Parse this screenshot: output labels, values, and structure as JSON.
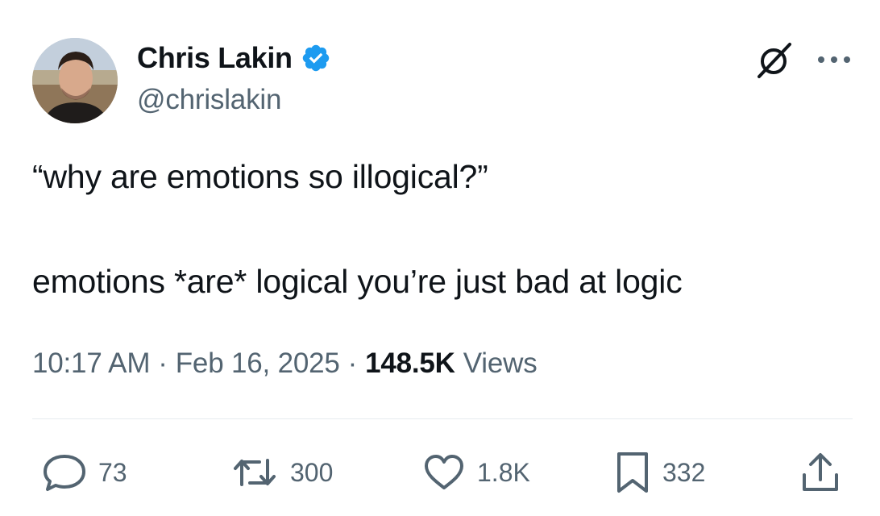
{
  "author": {
    "display_name": "Chris Lakin",
    "handle": "@chrislakin",
    "verified": true,
    "verified_color": "#1d9bf0"
  },
  "tweet": {
    "line1": "“why are emotions so illogical?”",
    "line2": "emotions *are* logical you’re just bad at logic"
  },
  "meta": {
    "time": "10:17 AM",
    "separator": "·",
    "date": "Feb 16, 2025",
    "views_count": "148.5K",
    "views_label": "Views"
  },
  "actions": {
    "replies": "73",
    "reposts": "300",
    "likes": "1.8K",
    "bookmarks": "332"
  },
  "icons": {
    "reply": "reply-bubble-icon",
    "repost": "repost-icon",
    "like": "heart-icon",
    "bookmark": "bookmark-icon",
    "share": "share-icon",
    "grok": "grok-icon",
    "more": "more-dots-icon",
    "verified": "verified-badge-icon"
  },
  "colors": {
    "text_primary": "#0f1419",
    "text_secondary": "#536471",
    "divider": "#e6ecf0"
  }
}
